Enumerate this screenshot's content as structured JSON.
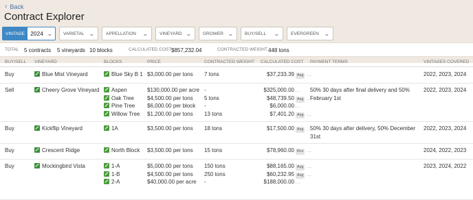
{
  "back_label": "Back",
  "title": "Contract Explorer",
  "filters": {
    "vintage_label": "VINTAGE",
    "vintage_value": "2024",
    "dropdowns": [
      "VARIETAL",
      "APPELLATION",
      "VINEYARD",
      "GROWER",
      "BUY/SELL",
      "EVERGREEN"
    ]
  },
  "summary": {
    "total_label": "TOTAL",
    "contracts": "5 contracts",
    "vineyards": "5 vineyards",
    "blocks": "10 blocks",
    "cost_label": "CALCULATED COST",
    "cost_value": "$857,232.04",
    "weight_label": "CONTRACTED WEIGHT",
    "weight_value": "448 tons"
  },
  "columns": {
    "buy_sell": "BUY/SELL",
    "vineyard": "VINEYARD",
    "blocks": "BLOCKS",
    "price": "PRICE",
    "weight": "CONTRACTED WEIGHT",
    "cost": "CALCULATED COST",
    "terms": "PAYMENT TERMS",
    "vintages": "VINTAGES COVERED"
  },
  "rows": [
    {
      "buy_sell": "Buy",
      "vineyard": "Blue Mist Vineyard",
      "blocks": [
        "Blue Sky B 1"
      ],
      "prices": [
        "$3,000.00 per tons"
      ],
      "weights": [
        "7 tons"
      ],
      "costs": [
        "$37,233.39"
      ],
      "badges": [
        "Avg"
      ],
      "terms": [
        "",
        ""
      ],
      "vintages": "2022, 2023, 2024"
    },
    {
      "buy_sell": "Sell",
      "vineyard": "Cheery Grove Vineyard",
      "blocks": [
        "Aspen",
        "Oak Tree",
        "Pine Tree",
        "Willow Tree"
      ],
      "prices": [
        "$130,000.00 per acre",
        "$4,500.00 per tons",
        "$6,000.00 per block",
        "$1,200.00 per tons"
      ],
      "weights": [
        "-",
        "5 tons",
        "-",
        "13 tons"
      ],
      "costs": [
        "$325,000.00",
        "$48,739.50",
        "$6,000.00",
        "$7,401.20"
      ],
      "badges": [
        "",
        "Avg",
        "",
        "Avg"
      ],
      "terms": [
        "50% 30 days after final delivery and 50%",
        "February 1st"
      ],
      "vintages": "2022, 2023, 2024"
    },
    {
      "buy_sell": "Buy",
      "vineyard": "Kickflip Vineyard",
      "blocks": [
        "1A"
      ],
      "prices": [
        "$3,500.00 per tons"
      ],
      "weights": [
        "18 tons"
      ],
      "costs": [
        "$17,500.00"
      ],
      "badges": [
        "Avg"
      ],
      "terms": [
        "50% 30 days after delivery, 50% December",
        "31st"
      ],
      "vintages": "2022, 2023, 2024"
    },
    {
      "buy_sell": "Buy",
      "vineyard": "Crescent Ridge",
      "blocks": [
        "North Block"
      ],
      "prices": [
        "$3,500.00 per tons"
      ],
      "weights": [
        "15 tons"
      ],
      "costs": [
        "$78,960.00"
      ],
      "badges": [
        "Rcv"
      ],
      "terms": [
        "",
        ""
      ],
      "vintages": "2024, 2022, 2023"
    },
    {
      "buy_sell": "Buy",
      "vineyard": "Mockingbird Vista",
      "blocks": [
        "1-A",
        "1-B",
        "2-A"
      ],
      "prices": [
        "$5,000.00 per tons",
        "$4,500.00 per tons",
        "$40,000.00 per acre"
      ],
      "weights": [
        "150 tons",
        "250 tons",
        "-"
      ],
      "costs": [
        "$88,165.00",
        "$60,232.95",
        "$188,000.00"
      ],
      "badges": [
        "Avg",
        "Avg",
        ""
      ],
      "terms": [
        "",
        ""
      ],
      "vintages": "2023, 2024, 2022"
    }
  ]
}
